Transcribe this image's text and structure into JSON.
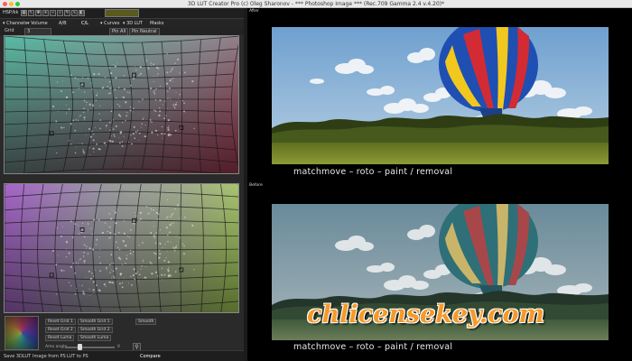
{
  "window": {
    "title": "3D LUT Creator Pro (c) Oleg Sharonov - *** Photoshop Image *** (Rec.709 Gamma 2.4 v.4.20)*"
  },
  "toolbar": {
    "mode_label": "HSP/kk",
    "icons": [
      "grid-icon",
      "cursor-icon",
      "move-icon",
      "plus-icon",
      "minus-icon",
      "zoom-icon",
      "eyedropper-icon",
      "curve-icon",
      "lut-icon"
    ]
  },
  "tabs": [
    {
      "label": "Channels",
      "icon": "chevron-down-icon"
    },
    {
      "label": "Volume",
      "icon": "chevron-down-icon"
    },
    {
      "label": "A/B"
    },
    {
      "label": "C/L"
    },
    {
      "label": "Curves",
      "icon": "chevron-down-icon"
    },
    {
      "label": "3D LUT"
    },
    {
      "label": "Masks"
    }
  ],
  "grid_controls": {
    "grid_label": "Grid",
    "grid_value": "3",
    "pin_all": "Pin All",
    "pin_neutral": "Pin Neutral"
  },
  "buttons": {
    "reset_grid_1": "Reset Grid 1",
    "smooth_grid_1": "Smooth Grid 1",
    "reset_grid_2": "Reset Grid 2",
    "smooth_grid_2": "Smooth Grid 2",
    "reset_luma": "Reset Luma",
    "smooth_luma": "Smooth Luma",
    "smooth": "Smooth"
  },
  "slider": {
    "label": "Amo angle",
    "value": "0",
    "level": 0.3
  },
  "footer": {
    "save_3dlut": "Save 3DLUT",
    "image_from_ps": "Image from PS",
    "lut_to_ps": "LUT to PS",
    "compare": "Compare"
  },
  "preview": {
    "after_label": "After",
    "before_label": "Before",
    "caption_after": "matchmove – roto – paint / removal",
    "caption_before": "matchmove – roto – paint / removal"
  },
  "watermark": {
    "text": "chlicensekey.com"
  },
  "colors": {
    "accent": "#f49a2c",
    "panel": "#2a2a2a",
    "background": "#000000"
  }
}
